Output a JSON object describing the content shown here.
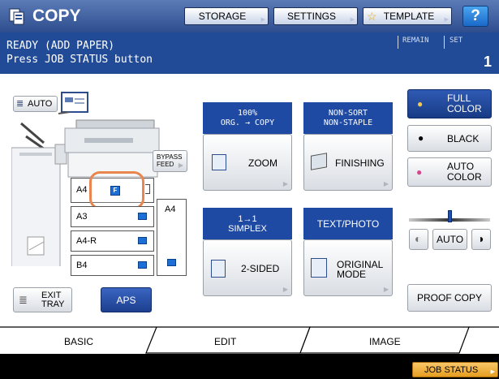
{
  "header": {
    "title": "COPY",
    "buttons": [
      "STORAGE",
      "SETTINGS",
      "TEMPLATE"
    ],
    "help_label": "?"
  },
  "status": {
    "line1": "READY (ADD PAPER)",
    "line2": "Press JOB STATUS button",
    "remain_label": "REMAIN",
    "set_label": "SET",
    "set_value": "1"
  },
  "paper": {
    "auto_label": "AUTO",
    "bypass_label": "BYPASS FEED",
    "trays": [
      "A4",
      "A3",
      "A4-R",
      "B4"
    ],
    "lcf_label": "A4",
    "exit_tray_label": "EXIT TRAY",
    "aps_label": "APS"
  },
  "functions": {
    "zoom_status_line1": "100%",
    "zoom_status_line2": "ORG. → COPY",
    "zoom_label": "ZOOM",
    "finishing_status_line1": "NON-SORT",
    "finishing_status_line2": "NON-STAPLE",
    "finishing_label": "FINISHING",
    "duplex_status_line1": "1→1",
    "duplex_status_line2": "SIMPLEX",
    "duplex_label": "2-SIDED",
    "mode_status": "TEXT/PHOTO",
    "mode_label_line1": "ORIGINAL",
    "mode_label_line2": "MODE"
  },
  "color": {
    "full_color_line1": "FULL",
    "full_color_line2": "COLOR",
    "black_label": "BLACK",
    "auto_color_line1": "AUTO",
    "auto_color_line2": "COLOR",
    "density_auto_label": "AUTO",
    "density_level_fraction": 0.5,
    "proof_copy_label": "PROOF COPY"
  },
  "tabs": [
    "BASIC",
    "EDIT",
    "IMAGE"
  ],
  "job_status_label": "JOB STATUS",
  "colors": {
    "header_blue": "#2d4d8e",
    "status_blue": "#224b97",
    "label_blue": "#1f4aa3",
    "selected_highlight": "#e8864e",
    "job_status_orange": "#f0b040"
  }
}
